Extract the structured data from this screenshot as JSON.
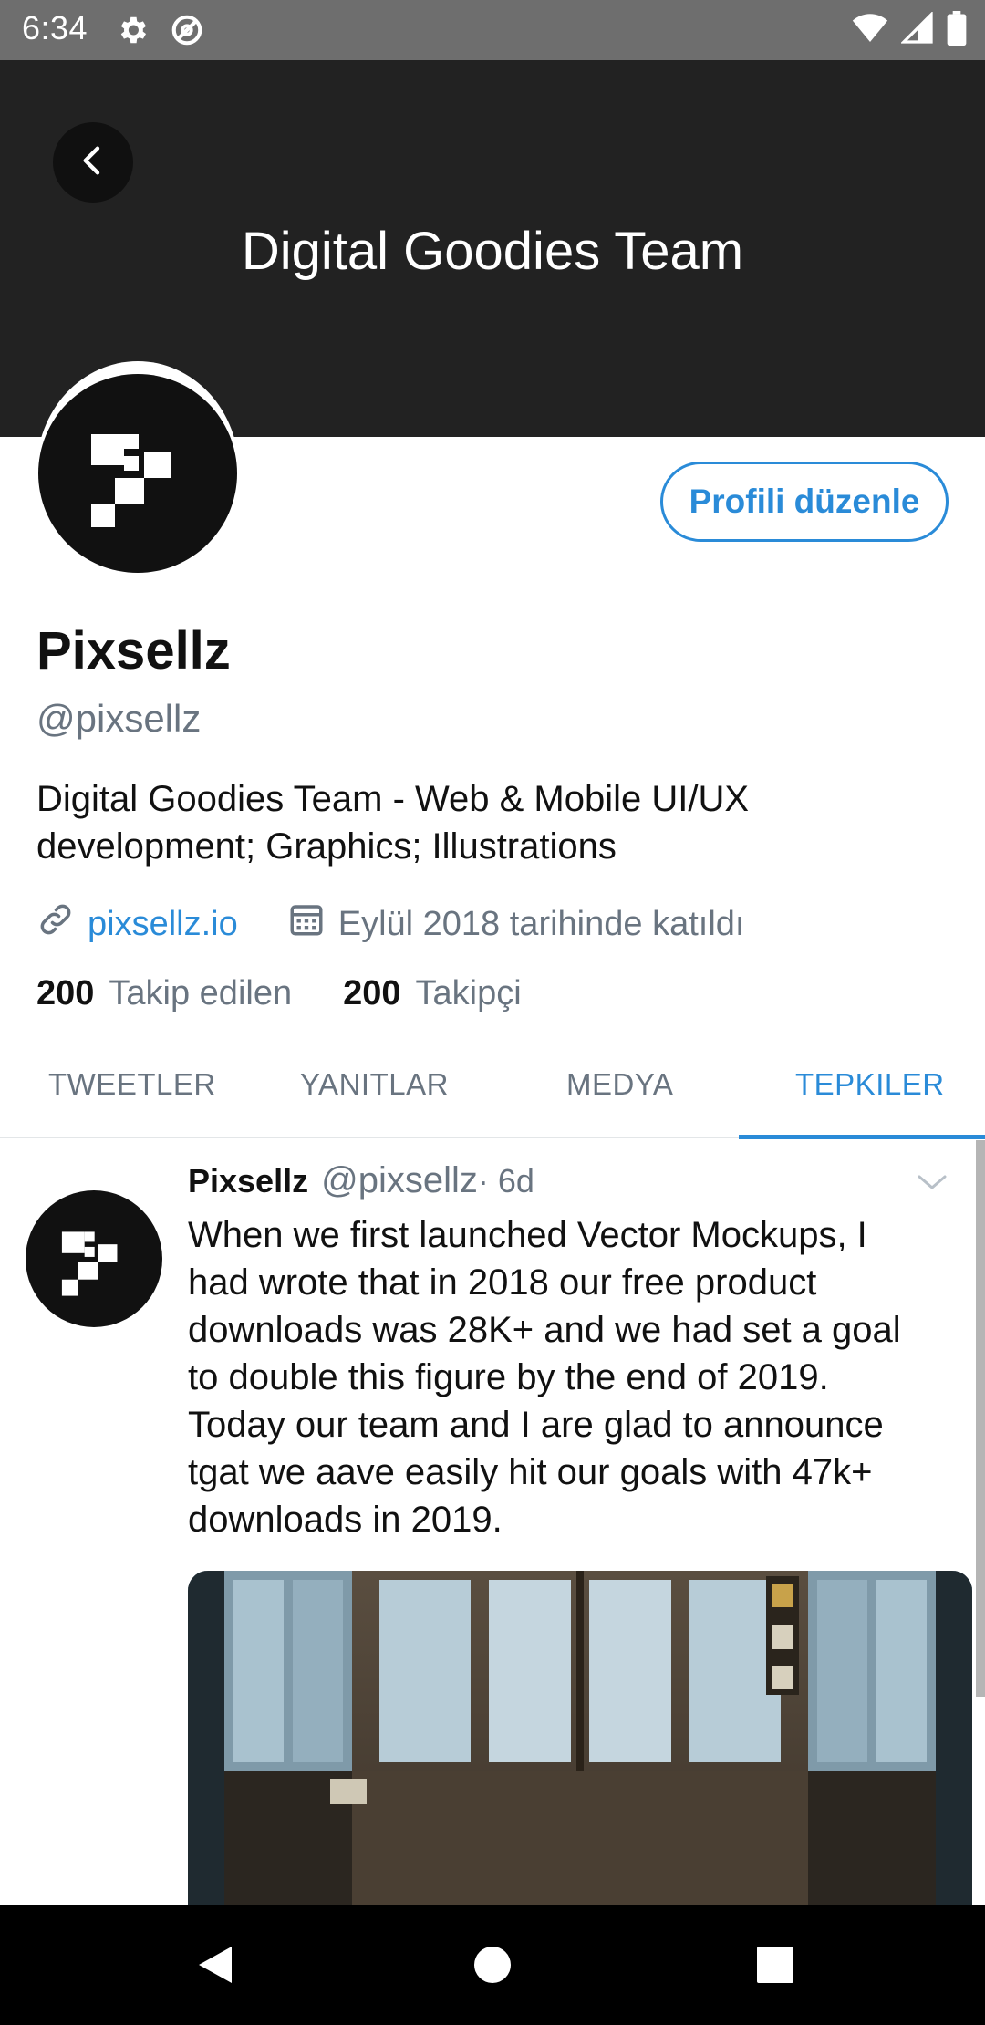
{
  "status_bar": {
    "time": "6:34",
    "icons": [
      "gear-icon",
      "at-sign-icon",
      "wifi-icon",
      "signal-icon",
      "battery-icon"
    ]
  },
  "header": {
    "title": "Digital Goodies Team",
    "back_icon": "chevron-left-icon",
    "background": "#222222"
  },
  "profile": {
    "edit_button": "Profili düzenle",
    "name": "Pixsellz",
    "handle": "@pixsellz",
    "bio": "Digital Goodies Team - Web & Mobile UI/UX development; Graphics; Illustrations",
    "website": "pixsellz.io",
    "joined": "Eylül 2018 tarihinde katıldı",
    "following_count": "200",
    "following_label": "Takip edilen",
    "followers_count": "200",
    "followers_label": "Takipçi"
  },
  "tabs": [
    {
      "label": "TWEETLER",
      "active": false
    },
    {
      "label": "YANITLAR",
      "active": false
    },
    {
      "label": "MEDYA",
      "active": false
    },
    {
      "label": "TEPKILER",
      "active": true
    }
  ],
  "tweet": {
    "author": "Pixsellz",
    "handle": "@pixsellz",
    "time": "· 6d",
    "text": "When we first launched Vector Mockups, I had wrote that in 2018 our free product downloads was 28K+ and we had set a goal to double this figure by the end of 2019. Today our team and I are glad to announce tgat we aave easily hit our goals with 47k+ downloads in 2019."
  },
  "colors": {
    "accent": "#2a8bd8",
    "secondary_text": "#697480",
    "status_bar": "#6e6e6e"
  },
  "nav_bar": {
    "icons": [
      "back-triangle-icon",
      "home-circle-icon",
      "recents-square-icon"
    ]
  }
}
